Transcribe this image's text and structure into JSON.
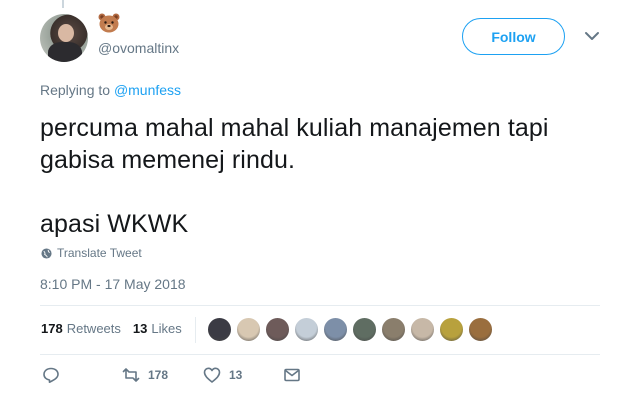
{
  "tweet": {
    "handle": "@ovomaltinx",
    "follow_label": "Follow",
    "replying_prefix": "Replying to ",
    "replying_to": "@munfess",
    "text": "percuma mahal mahal kuliah manajemen tapi\ngabisa memenej rindu.\n\napasi WKWK",
    "translate_label": "Translate Tweet",
    "timestamp": "8:10 PM - 17 May 2018"
  },
  "stats": {
    "retweets_count": "178",
    "retweets_label": "Retweets",
    "likes_count": "13",
    "likes_label": "Likes"
  },
  "likers": [
    {
      "name": "liker-avatar",
      "color": "#3b3b44"
    },
    {
      "name": "liker-avatar",
      "color": "#d8c8b2"
    },
    {
      "name": "liker-avatar",
      "color": "#6e5b5a"
    },
    {
      "name": "liker-avatar",
      "color": "#c4ced8"
    },
    {
      "name": "liker-avatar",
      "color": "#7d8fa8"
    },
    {
      "name": "liker-avatar",
      "color": "#5f6d62"
    },
    {
      "name": "liker-avatar",
      "color": "#8a7e6c"
    },
    {
      "name": "liker-avatar",
      "color": "#c7b8a7"
    },
    {
      "name": "liker-avatar",
      "color": "#b8a13d"
    },
    {
      "name": "liker-avatar",
      "color": "#9a6e3e"
    }
  ],
  "actions": {
    "retweet_count": "178",
    "like_count": "13"
  },
  "colors": {
    "accent": "#1da1f2",
    "muted": "#657786",
    "text": "#14171a",
    "divider": "#e6ecf0"
  },
  "icons": [
    "bear-emoji-icon",
    "chevron-down-icon",
    "globe-icon",
    "reply-icon",
    "retweet-icon",
    "heart-icon",
    "envelope-icon"
  ]
}
